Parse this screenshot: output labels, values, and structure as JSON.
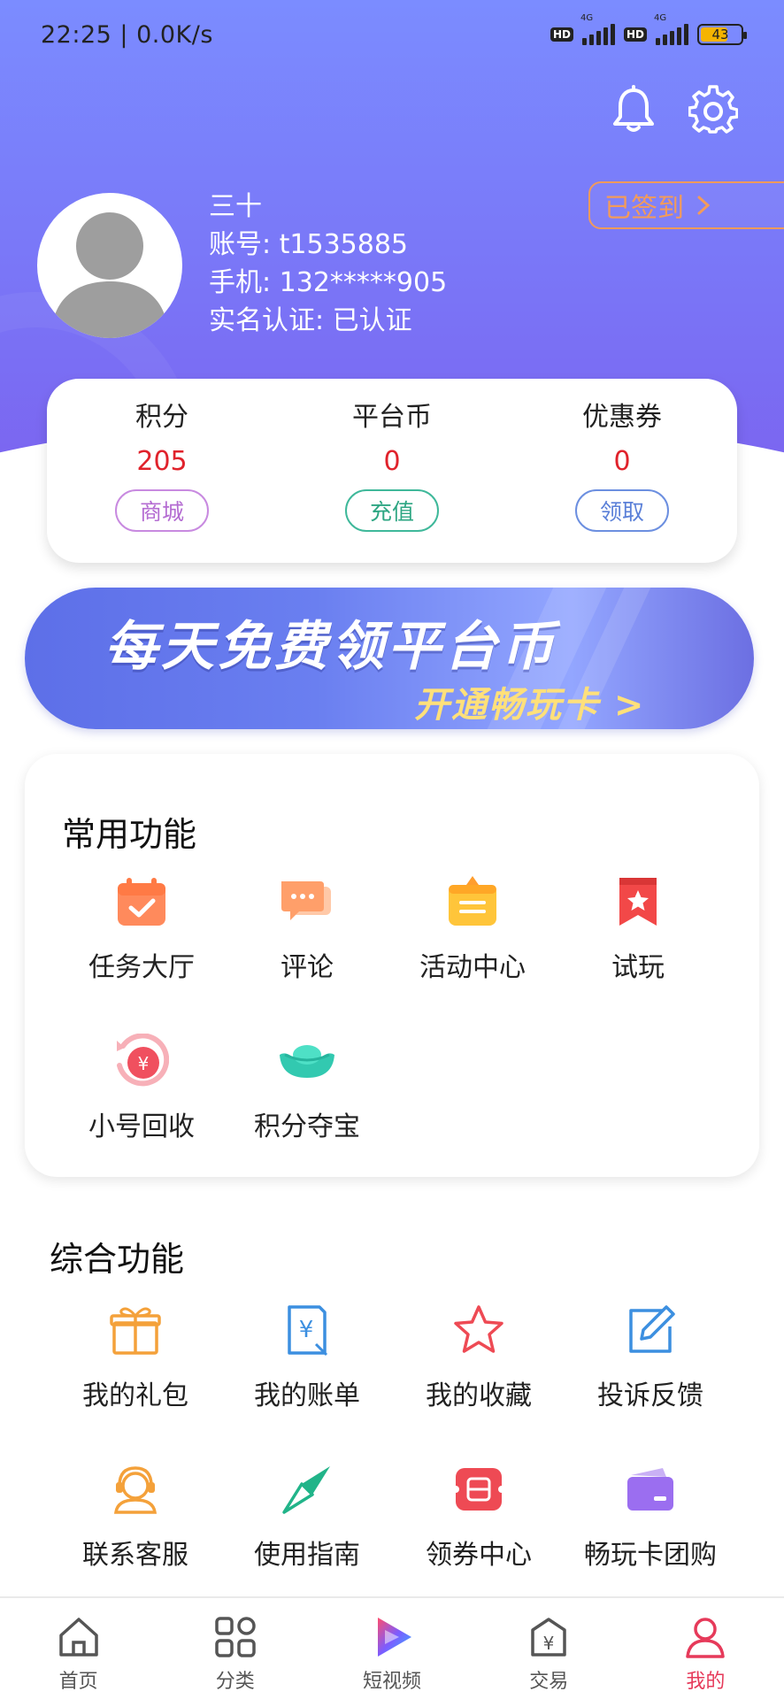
{
  "status_bar": {
    "time": "22:25 | 0.0K/s",
    "hd1": "HD",
    "net1": "4G",
    "hd2": "HD",
    "net2": "4G",
    "battery": "43"
  },
  "profile": {
    "name": "三十",
    "account": "账号: t1535885",
    "phone": "手机: 132*****905",
    "realname": "实名认证: 已认证",
    "signin_label": "已签到"
  },
  "stats": [
    {
      "label": "积分",
      "value": "205",
      "button": "商城"
    },
    {
      "label": "平台币",
      "value": "0",
      "button": "充值"
    },
    {
      "label": "优惠券",
      "value": "0",
      "button": "领取"
    }
  ],
  "banner": {
    "title": "每天免费领平台币",
    "subtitle": "开通畅玩卡 >"
  },
  "common": {
    "title": "常用功能",
    "items": [
      {
        "label": "任务大厅",
        "icon": "task-calendar-icon"
      },
      {
        "label": "评论",
        "icon": "comment-icon"
      },
      {
        "label": "活动中心",
        "icon": "activity-bag-icon"
      },
      {
        "label": "试玩",
        "icon": "trial-star-flag-icon"
      },
      {
        "label": "小号回收",
        "icon": "recycle-yen-icon"
      },
      {
        "label": "积分夺宝",
        "icon": "gold-ingot-icon"
      }
    ]
  },
  "general": {
    "title": "综合功能",
    "items": [
      {
        "label": "我的礼包",
        "icon": "gift-icon"
      },
      {
        "label": "我的账单",
        "icon": "bill-icon"
      },
      {
        "label": "我的收藏",
        "icon": "star-icon"
      },
      {
        "label": "投诉反馈",
        "icon": "edit-feedback-icon"
      },
      {
        "label": "联系客服",
        "icon": "customer-service-icon"
      },
      {
        "label": "使用指南",
        "icon": "compass-icon"
      },
      {
        "label": "领券中心",
        "icon": "coupon-icon"
      },
      {
        "label": "畅玩卡团购",
        "icon": "card-icon"
      }
    ]
  },
  "tabs": [
    {
      "label": "首页",
      "icon": "home-icon"
    },
    {
      "label": "分类",
      "icon": "category-icon"
    },
    {
      "label": "短视频",
      "icon": "video-play-icon"
    },
    {
      "label": "交易",
      "icon": "trade-icon"
    },
    {
      "label": "我的",
      "icon": "profile-icon",
      "active": true
    }
  ],
  "colors": {
    "header_gradient_top": "#7b8cff",
    "header_gradient_bottom": "#7b63ef",
    "value_red": "#e0222b",
    "active_tab": "#e63a5a"
  }
}
